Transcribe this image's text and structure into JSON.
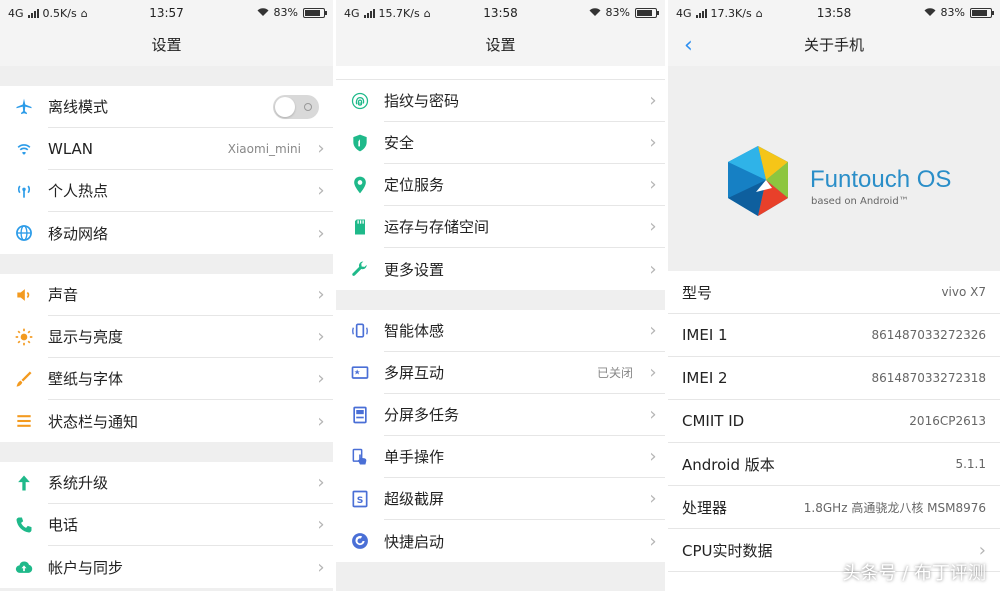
{
  "p1": {
    "status": {
      "net": "4G",
      "speed": "0.5K/s",
      "time": "13:57",
      "battery": "83%",
      "battery_level": 0.83
    },
    "title": "设置",
    "groups": [
      [
        {
          "label": "离线模式",
          "icon": "airplane-icon",
          "color": "#2b9be8",
          "toggle": true
        },
        {
          "label": "WLAN",
          "icon": "wifi-icon",
          "color": "#2b9be8",
          "value": "Xiaomi_mini"
        },
        {
          "label": "个人热点",
          "icon": "hotspot-icon",
          "color": "#2b9be8"
        },
        {
          "label": "移动网络",
          "icon": "globe-icon",
          "color": "#2b9be8"
        }
      ],
      [
        {
          "label": "声音",
          "icon": "speaker-icon",
          "color": "#f39a1f"
        },
        {
          "label": "显示与亮度",
          "icon": "sun-icon",
          "color": "#f39a1f"
        },
        {
          "label": "壁纸与字体",
          "icon": "brush-icon",
          "color": "#f39a1f"
        },
        {
          "label": "状态栏与通知",
          "icon": "list-icon",
          "color": "#f39a1f"
        }
      ],
      [
        {
          "label": "系统升级",
          "icon": "arrow-up-icon",
          "color": "#1fb98a"
        },
        {
          "label": "电话",
          "icon": "phone-icon",
          "color": "#1fb98a"
        },
        {
          "label": "帐户与同步",
          "icon": "cloud-icon",
          "color": "#1fb98a"
        }
      ]
    ]
  },
  "p2": {
    "status": {
      "net": "4G",
      "speed": "15.7K/s",
      "time": "13:58",
      "battery": "83%",
      "battery_level": 0.83
    },
    "title": "设置",
    "groups": [
      [
        {
          "label": "指纹与密码",
          "icon": "fingerprint-icon",
          "color": "#1fb98a"
        },
        {
          "label": "安全",
          "icon": "shield-icon",
          "color": "#1fb98a"
        },
        {
          "label": "定位服务",
          "icon": "location-icon",
          "color": "#1fb98a"
        },
        {
          "label": "运存与存储空间",
          "icon": "sdcard-icon",
          "color": "#1fb98a"
        },
        {
          "label": "更多设置",
          "icon": "wrench-icon",
          "color": "#1fb98a"
        }
      ],
      [
        {
          "label": "智能体感",
          "icon": "motion-icon",
          "color": "#4a6fd6"
        },
        {
          "label": "多屏互动",
          "icon": "screen-icon",
          "color": "#4a6fd6",
          "value": "已关闭"
        },
        {
          "label": "分屏多任务",
          "icon": "split-icon",
          "color": "#4a6fd6"
        },
        {
          "label": "单手操作",
          "icon": "hand-icon",
          "color": "#4a6fd6"
        },
        {
          "label": "超级截屏",
          "icon": "screenshot-icon",
          "color": "#4a6fd6"
        },
        {
          "label": "快捷启动",
          "icon": "quicklaunch-icon",
          "color": "#4a6fd6"
        }
      ]
    ]
  },
  "p3": {
    "status": {
      "net": "4G",
      "speed": "17.3K/s",
      "time": "13:58",
      "battery": "83%",
      "battery_level": 0.83
    },
    "title": "关于手机",
    "logo_text": "Funtouch OS",
    "logo_sub": "based on Android™",
    "rows": [
      {
        "k": "型号",
        "v": "vivo X7"
      },
      {
        "k": "IMEI 1",
        "v": "861487033272326"
      },
      {
        "k": "IMEI 2",
        "v": "861487033272318"
      },
      {
        "k": "CMIIT ID",
        "v": "2016CP2613"
      },
      {
        "k": "Android 版本",
        "v": "5.1.1"
      },
      {
        "k": "处理器",
        "v": "1.8GHz 高通骁龙八核 MSM8976"
      },
      {
        "k": "CPU实时数据",
        "v": "",
        "chev": true
      }
    ]
  },
  "watermark": "头条号 / 布丁评测",
  "colors": {
    "accent": "#2b8ef0"
  }
}
